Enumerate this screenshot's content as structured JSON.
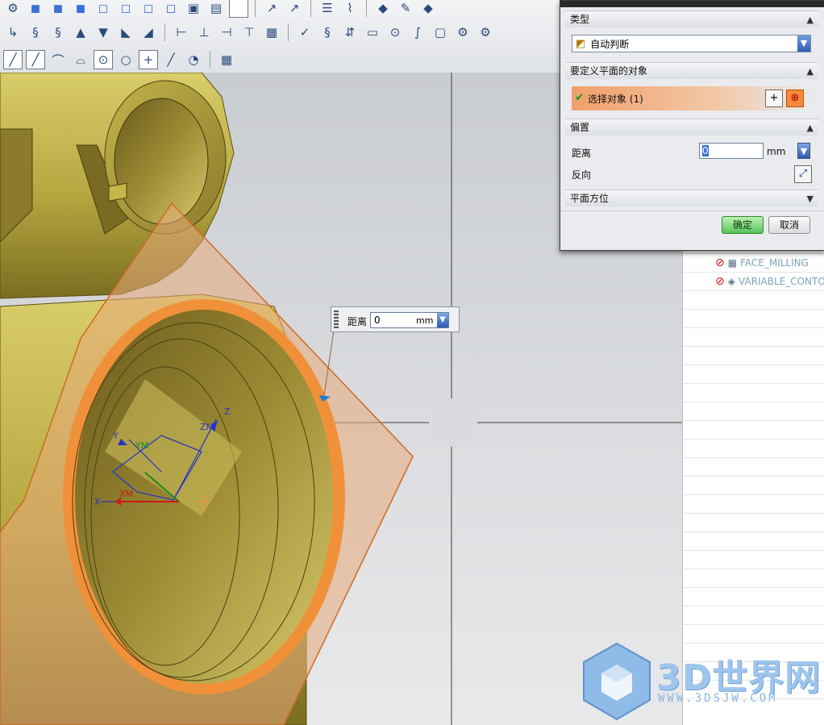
{
  "dialog": {
    "type_section": "类型",
    "type_value": "自动判断",
    "objects_section": "要定义平面的对象",
    "select_label": "选择对象 (1)",
    "offset_section": "偏置",
    "distance_label": "距离",
    "distance_value": "0",
    "unit": "mm",
    "reverse_label": "反向",
    "orientation_section": "平面方位",
    "ok": "确定",
    "cancel": "取消"
  },
  "floating_input": {
    "label": "距离",
    "value": "0",
    "unit": "mm"
  },
  "navigator": {
    "items": [
      "FACE_MILLING",
      "VARIABLE_CONTO"
    ]
  },
  "viewport": {
    "axes": {
      "zm": "ZM",
      "z": "Z",
      "ym": "YM",
      "y": "Y",
      "xm": "XM",
      "x": "X"
    }
  },
  "watermark": {
    "title": "3D世界网",
    "url": "WWW.3DSJW.COM"
  },
  "colors": {
    "part_body": "#c7b64a",
    "highlight_edge": "#f0913a",
    "plane_fill": "#e8a97a",
    "ok_button": "#58c35a"
  }
}
